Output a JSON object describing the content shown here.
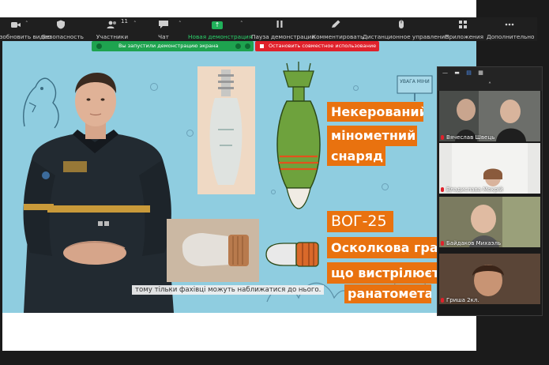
{
  "toolbar": {
    "items": [
      {
        "label": "Возобновить видео",
        "icon": "video-icon"
      },
      {
        "label": "Безопасность",
        "icon": "shield-icon"
      },
      {
        "label": "Участники",
        "icon": "participants-icon",
        "count": "11"
      },
      {
        "label": "Чат",
        "icon": "chat-icon"
      },
      {
        "label": "Новая демонстрация",
        "icon": "share-screen-icon"
      },
      {
        "label": "Пауза демонстрации",
        "icon": "pause-icon"
      },
      {
        "label": "Комментировать",
        "icon": "pencil-icon"
      },
      {
        "label": "Дистанционное управление",
        "icon": "mouse-icon"
      },
      {
        "label": "Приложения",
        "icon": "apps-icon"
      },
      {
        "label": "Дополнительно",
        "icon": "more-icon"
      }
    ]
  },
  "banner": {
    "sharing_text": "Вы запустили демонстрацию экрана",
    "stop_text": "Остановить совместное использование"
  },
  "slide": {
    "caption": "тому тільки фахівці можуть наближатися до нього.",
    "headline_1": [
      "Некерований",
      "мінометний",
      "снаряд"
    ],
    "headline_2": [
      "ВОГ-25",
      "Осколкова гран",
      "що вистрілюєт",
      "ранатомета"
    ],
    "sign_text": "УВАГА МІНИ"
  },
  "video_panel": {
    "participants": [
      {
        "name": "Вячеслав Швець"
      },
      {
        "name": "Владислава Мокрій"
      },
      {
        "name": "Байдаков Михаэль"
      },
      {
        "name": "Гриша 2кл."
      }
    ]
  },
  "colors": {
    "toolbar_bg": "#1f1f1f",
    "slide_bg": "#8fcde0",
    "orange_label": "#e9720f",
    "banner_green": "#1ea34f",
    "banner_red": "#e0212b"
  }
}
